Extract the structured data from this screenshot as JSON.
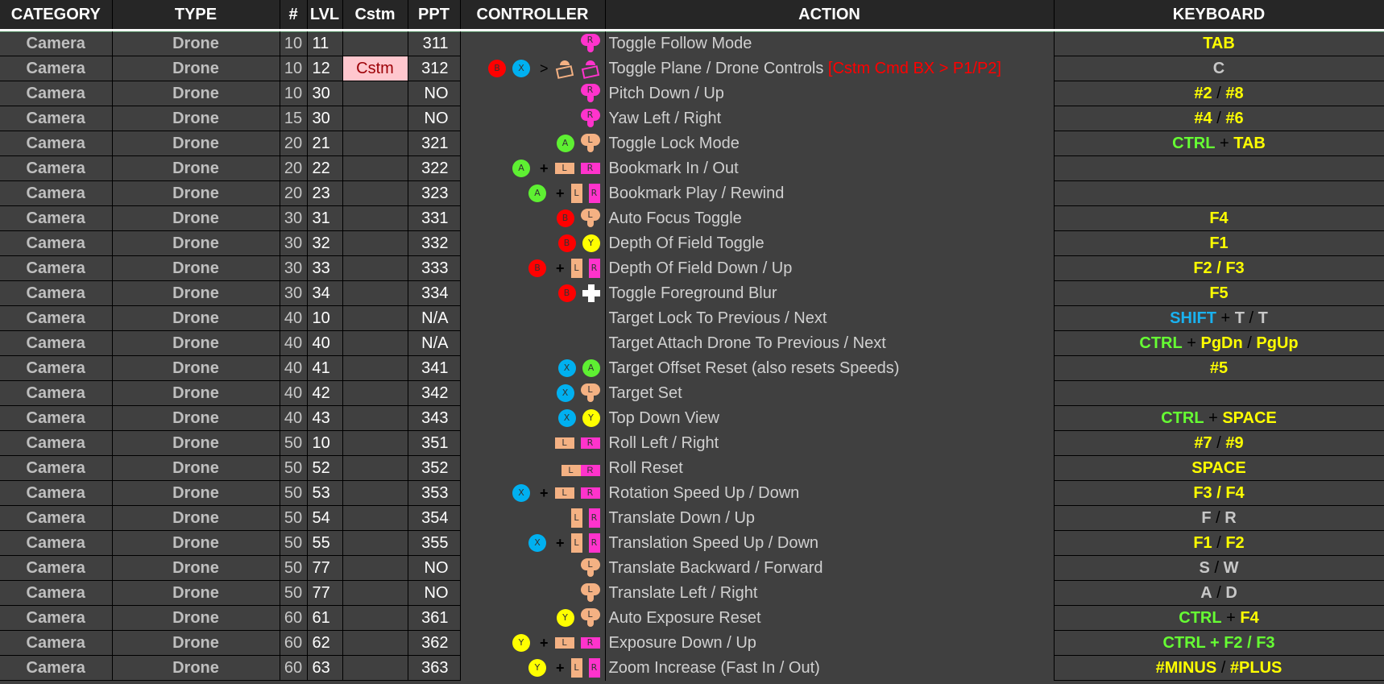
{
  "headers": {
    "category": "CATEGORY",
    "type": "TYPE",
    "num": "#",
    "lvl": "LVL",
    "cstm": "Cstm",
    "ppt": "PPT",
    "controller": "CONTROLLER",
    "action": "ACTION",
    "keyboard": "KEYBOARD"
  },
  "colors": {
    "header_bg": "#262626",
    "body_bg": "#404040",
    "cstm_bg": "#ffc7ce",
    "cstm_text": "#9c0006",
    "key_yellow": "#ffff00",
    "key_green": "#66ff33",
    "key_blue": "#1ab2f0",
    "key_gray": "#c8c8c8",
    "btn_a": "#5ef032",
    "btn_b": "#ff0000",
    "btn_x": "#00b0f0",
    "btn_y": "#ffff00",
    "left_input": "#f4b183",
    "right_input": "#ff33cc"
  },
  "rows": [
    {
      "category": "Camera",
      "type": "Drone",
      "num": "10",
      "lvl": "11",
      "cstm": "",
      "ppt": "311",
      "controller": [
        "stick-r"
      ],
      "action": "Toggle Follow Mode",
      "action_note": "",
      "keyboard": [
        [
          "TAB",
          "y"
        ]
      ]
    },
    {
      "category": "Camera",
      "type": "Drone",
      "num": "10",
      "lvl": "12",
      "cstm": "Cstm",
      "ppt": "312",
      "controller": [
        "btn-b",
        "btn-x",
        ">",
        "view-l",
        "view-r"
      ],
      "action": "Toggle Plane / Drone Controls",
      "action_note": "[Cstm Cmd BX > P1/P2]",
      "keyboard": [
        [
          "C",
          "w"
        ]
      ]
    },
    {
      "category": "Camera",
      "type": "Drone",
      "num": "10",
      "lvl": "30",
      "cstm": "",
      "ppt": "NO",
      "controller": [
        "stick-r"
      ],
      "action": "Pitch Down / Up",
      "action_note": "",
      "keyboard": [
        [
          "#2",
          "y"
        ],
        [
          " / ",
          "k"
        ],
        [
          "#8",
          "y"
        ]
      ]
    },
    {
      "category": "Camera",
      "type": "Drone",
      "num": "15",
      "lvl": "30",
      "cstm": "",
      "ppt": "NO",
      "controller": [
        "stick-r"
      ],
      "action": "Yaw Left / Right",
      "action_note": "",
      "keyboard": [
        [
          "#4",
          "y"
        ],
        [
          " / ",
          "k"
        ],
        [
          "#6",
          "y"
        ]
      ]
    },
    {
      "category": "Camera",
      "type": "Drone",
      "num": "20",
      "lvl": "21",
      "cstm": "",
      "ppt": "321",
      "controller": [
        "btn-a",
        "stick-l"
      ],
      "action": "Toggle Lock Mode",
      "action_note": "",
      "keyboard": [
        [
          "CTRL",
          "g"
        ],
        [
          " + ",
          "k"
        ],
        [
          "TAB",
          "y"
        ]
      ]
    },
    {
      "category": "Camera",
      "type": "Drone",
      "num": "20",
      "lvl": "22",
      "cstm": "",
      "ppt": "322",
      "controller": [
        "btn-a",
        "+",
        "lb",
        "rb"
      ],
      "action": "Bookmark In / Out",
      "action_note": "",
      "keyboard": []
    },
    {
      "category": "Camera",
      "type": "Drone",
      "num": "20",
      "lvl": "23",
      "cstm": "",
      "ppt": "323",
      "controller": [
        "btn-a",
        "+",
        "lt",
        "rt"
      ],
      "action": "Bookmark Play / Rewind",
      "action_note": "",
      "keyboard": []
    },
    {
      "category": "Camera",
      "type": "Drone",
      "num": "30",
      "lvl": "31",
      "cstm": "",
      "ppt": "331",
      "controller": [
        "btn-b",
        "stick-l"
      ],
      "action": "Auto Focus Toggle",
      "action_note": "",
      "keyboard": [
        [
          "F4",
          "y"
        ]
      ]
    },
    {
      "category": "Camera",
      "type": "Drone",
      "num": "30",
      "lvl": "32",
      "cstm": "",
      "ppt": "332",
      "controller": [
        "btn-b",
        "btn-y"
      ],
      "action": "Depth Of Field Toggle",
      "action_note": "",
      "keyboard": [
        [
          "F1",
          "y"
        ]
      ]
    },
    {
      "category": "Camera",
      "type": "Drone",
      "num": "30",
      "lvl": "33",
      "cstm": "",
      "ppt": "333",
      "controller": [
        "btn-b",
        "+",
        "lt",
        "rt"
      ],
      "action": "Depth Of Field Down / Up",
      "action_note": "",
      "keyboard": [
        [
          "F2 / F3",
          "y"
        ]
      ]
    },
    {
      "category": "Camera",
      "type": "Drone",
      "num": "30",
      "lvl": "34",
      "cstm": "",
      "ppt": "334",
      "controller": [
        "btn-b",
        "dpad"
      ],
      "action": "Toggle Foreground Blur",
      "action_note": "",
      "keyboard": [
        [
          "F5",
          "y"
        ]
      ]
    },
    {
      "category": "Camera",
      "type": "Drone",
      "num": "40",
      "lvl": "10",
      "cstm": "",
      "ppt": "N/A",
      "controller": [],
      "action": "Target Lock To Previous / Next",
      "action_note": "",
      "keyboard": [
        [
          "SHIFT",
          "b"
        ],
        [
          " + ",
          "k"
        ],
        [
          "T",
          "w"
        ],
        [
          " / ",
          "k"
        ],
        [
          "T",
          "w"
        ]
      ]
    },
    {
      "category": "Camera",
      "type": "Drone",
      "num": "40",
      "lvl": "40",
      "cstm": "",
      "ppt": "N/A",
      "controller": [],
      "action": "Target Attach Drone To Previous / Next",
      "action_note": "",
      "keyboard": [
        [
          "CTRL",
          "g"
        ],
        [
          " + ",
          "k"
        ],
        [
          "PgDn",
          "y"
        ],
        [
          " / ",
          "k"
        ],
        [
          "PgUp",
          "y"
        ]
      ]
    },
    {
      "category": "Camera",
      "type": "Drone",
      "num": "40",
      "lvl": "41",
      "cstm": "",
      "ppt": "341",
      "controller": [
        "btn-x",
        "btn-a"
      ],
      "action": "Target Offset Reset (also resets Speeds)",
      "action_note": "",
      "keyboard": [
        [
          "#5",
          "y"
        ]
      ]
    },
    {
      "category": "Camera",
      "type": "Drone",
      "num": "40",
      "lvl": "42",
      "cstm": "",
      "ppt": "342",
      "controller": [
        "btn-x",
        "stick-l"
      ],
      "action": "Target Set",
      "action_note": "",
      "keyboard": []
    },
    {
      "category": "Camera",
      "type": "Drone",
      "num": "40",
      "lvl": "43",
      "cstm": "",
      "ppt": "343",
      "controller": [
        "btn-x",
        "btn-y"
      ],
      "action": "Top Down View",
      "action_note": "",
      "keyboard": [
        [
          "CTRL",
          "g"
        ],
        [
          " + ",
          "k"
        ],
        [
          "SPACE",
          "y"
        ]
      ]
    },
    {
      "category": "Camera",
      "type": "Drone",
      "num": "50",
      "lvl": "10",
      "cstm": "",
      "ppt": "351",
      "controller": [
        "lb",
        "rb"
      ],
      "action": "Roll Left / Right",
      "action_note": "",
      "keyboard": [
        [
          "#7",
          "y"
        ],
        [
          " / ",
          "k"
        ],
        [
          "#9",
          "y"
        ]
      ]
    },
    {
      "category": "Camera",
      "type": "Drone",
      "num": "50",
      "lvl": "52",
      "cstm": "",
      "ppt": "352",
      "controller": [
        "lbrb"
      ],
      "action": "Roll Reset",
      "action_note": "",
      "keyboard": [
        [
          "SPACE",
          "y"
        ]
      ]
    },
    {
      "category": "Camera",
      "type": "Drone",
      "num": "50",
      "lvl": "53",
      "cstm": "",
      "ppt": "353",
      "controller": [
        "btn-x",
        "+",
        "lb",
        "rb"
      ],
      "action": "Rotation Speed Up / Down",
      "action_note": "",
      "keyboard": [
        [
          "F3 / F4",
          "y"
        ]
      ]
    },
    {
      "category": "Camera",
      "type": "Drone",
      "num": "50",
      "lvl": "54",
      "cstm": "",
      "ppt": "354",
      "controller": [
        "lt",
        "rt"
      ],
      "action": "Translate Down / Up",
      "action_note": "",
      "keyboard": [
        [
          "F",
          "w"
        ],
        [
          " / ",
          "k"
        ],
        [
          "R",
          "w"
        ]
      ]
    },
    {
      "category": "Camera",
      "type": "Drone",
      "num": "50",
      "lvl": "55",
      "cstm": "",
      "ppt": "355",
      "controller": [
        "btn-x",
        "+",
        "lt",
        "rt"
      ],
      "action": "Translation Speed Up / Down",
      "action_note": "",
      "keyboard": [
        [
          "F1",
          "y"
        ],
        [
          " / ",
          "k"
        ],
        [
          "F2",
          "y"
        ]
      ]
    },
    {
      "category": "Camera",
      "type": "Drone",
      "num": "50",
      "lvl": "77",
      "cstm": "",
      "ppt": "NO",
      "controller": [
        "stick-l"
      ],
      "action": "Translate Backward / Forward",
      "action_note": "",
      "keyboard": [
        [
          "S",
          "w"
        ],
        [
          " / ",
          "k"
        ],
        [
          "W",
          "w"
        ]
      ]
    },
    {
      "category": "Camera",
      "type": "Drone",
      "num": "50",
      "lvl": "77",
      "cstm": "",
      "ppt": "NO",
      "controller": [
        "stick-l"
      ],
      "action": "Translate Left / Right",
      "action_note": "",
      "keyboard": [
        [
          "A",
          "w"
        ],
        [
          " / ",
          "k"
        ],
        [
          "D",
          "w"
        ]
      ]
    },
    {
      "category": "Camera",
      "type": "Drone",
      "num": "60",
      "lvl": "61",
      "cstm": "",
      "ppt": "361",
      "controller": [
        "btn-y",
        "stick-l"
      ],
      "action": "Auto Exposure Reset",
      "action_note": "",
      "keyboard": [
        [
          "CTRL",
          "g"
        ],
        [
          " + ",
          "k"
        ],
        [
          "F4",
          "y"
        ]
      ]
    },
    {
      "category": "Camera",
      "type": "Drone",
      "num": "60",
      "lvl": "62",
      "cstm": "",
      "ppt": "362",
      "controller": [
        "btn-y",
        "+",
        "lb",
        "rb"
      ],
      "action": "Exposure Down / Up",
      "action_note": "",
      "keyboard": [
        [
          "CTRL + F2 / F3",
          "g"
        ]
      ]
    },
    {
      "category": "Camera",
      "type": "Drone",
      "num": "60",
      "lvl": "63",
      "cstm": "",
      "ppt": "363",
      "controller": [
        "btn-y",
        "+",
        "lt",
        "rt"
      ],
      "action": "Zoom Increase (Fast In / Out)",
      "action_note": "",
      "keyboard": [
        [
          "#MINUS",
          "y"
        ],
        [
          " / ",
          "k"
        ],
        [
          "#PLUS",
          "y"
        ]
      ]
    }
  ]
}
